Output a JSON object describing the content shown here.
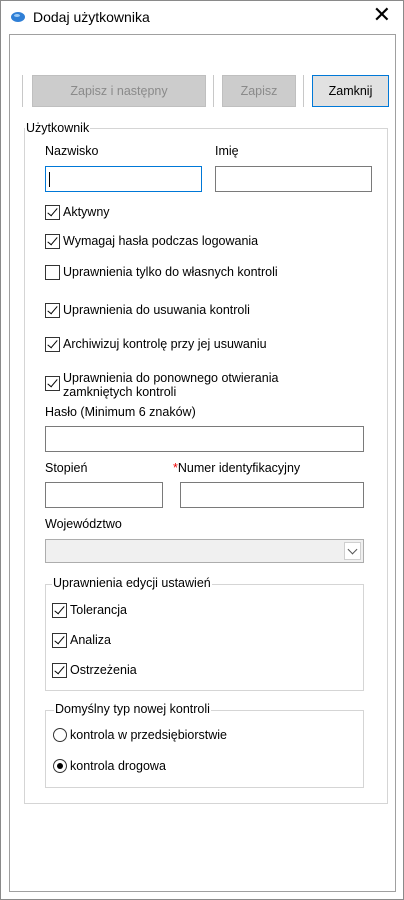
{
  "window": {
    "title": "Dodaj użytkownika"
  },
  "toolbar": {
    "save_next_label": "Zapisz i następny",
    "save_label": "Zapisz",
    "close_label": "Zamknij"
  },
  "user_group": {
    "legend": "Użytkownik",
    "surname_label": "Nazwisko",
    "surname_value": "",
    "firstname_label": "Imię",
    "firstname_value": "",
    "checkboxes": [
      {
        "label": "Aktywny",
        "checked": true
      },
      {
        "label": "Wymagaj hasła podczas logowania",
        "checked": true
      },
      {
        "label": "Uprawnienia tylko do własnych kontroli",
        "checked": false
      },
      {
        "label": "Uprawnienia do usuwania kontroli",
        "checked": true
      },
      {
        "label": "Archiwizuj kontrolę przy jej usuwaniu",
        "checked": true
      },
      {
        "label": "Uprawnienia do ponownego otwierania",
        "label2": "zamkniętych kontroli",
        "checked": true
      }
    ],
    "password_label": "Hasło (Minimum 6 znaków)",
    "password_value": "",
    "rank_label": "Stopień",
    "rank_value": "",
    "id_required_mark": "*",
    "id_label": "Numer identyfikacyjny",
    "id_value": "",
    "voivodeship_label": "Województwo",
    "voivodeship_value": ""
  },
  "settings_group": {
    "legend": "Uprawnienia edycji ustawień",
    "items": [
      {
        "label": "Tolerancja",
        "checked": true
      },
      {
        "label": "Analiza",
        "checked": true
      },
      {
        "label": "Ostrzeżenia",
        "checked": true
      }
    ]
  },
  "type_group": {
    "legend": "Domyślny typ nowej kontroli",
    "options": [
      {
        "label": "kontrola w przedsiębiorstwie",
        "selected": false
      },
      {
        "label": "kontrola drogowa",
        "selected": true
      }
    ]
  },
  "icons": {
    "app": "app-icon",
    "close": "close-icon",
    "dropdown": "chevron-down-icon"
  },
  "colors": {
    "focus_border": "#0078d7",
    "required": "#e00000"
  }
}
